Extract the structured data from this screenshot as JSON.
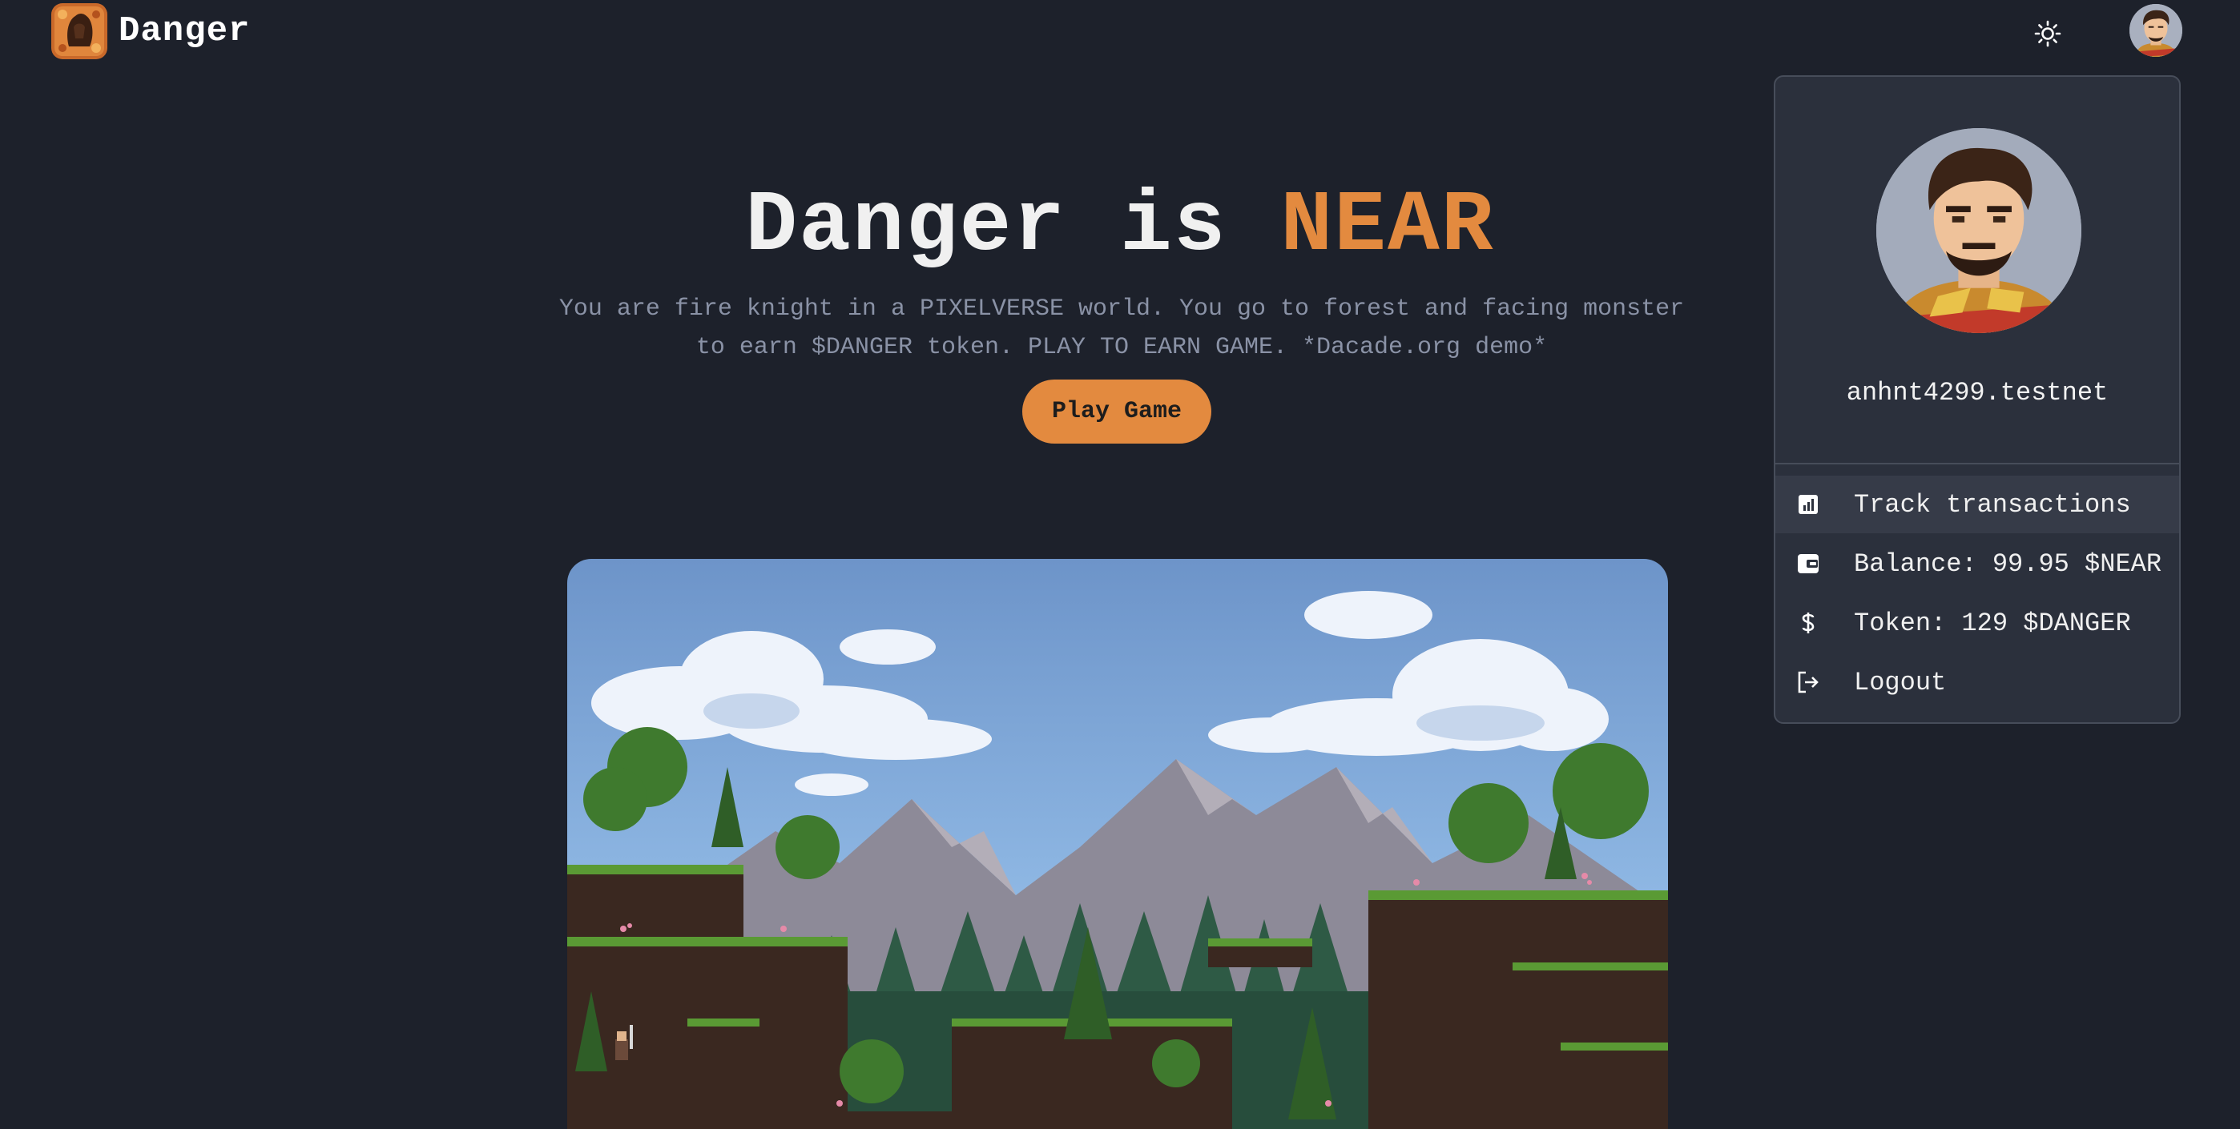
{
  "header": {
    "brand_name": "Danger"
  },
  "hero": {
    "title_prefix": "Danger is ",
    "title_accent": "NEAR",
    "description_line1": "You are fire knight in a PIXELVERSE world. You go to forest and facing monster",
    "description_line2": "to earn $DANGER token. PLAY TO EARN GAME. *Dacade.org demo*",
    "play_button_label": "Play Game"
  },
  "account_menu": {
    "account_id": "anhnt4299.testnet",
    "items": [
      {
        "icon": "bar-chart-icon",
        "label": "Track transactions"
      },
      {
        "icon": "wallet-icon",
        "label": "Balance: 99.95 $NEAR"
      },
      {
        "icon": "dollar-icon",
        "label": "Token: 129 $DANGER"
      },
      {
        "icon": "logout-icon",
        "label": "Logout"
      }
    ]
  },
  "colors": {
    "background": "#1d212b",
    "accent": "#e38a3f",
    "menu_background": "#2b303c",
    "muted_text": "#8a92a6"
  }
}
